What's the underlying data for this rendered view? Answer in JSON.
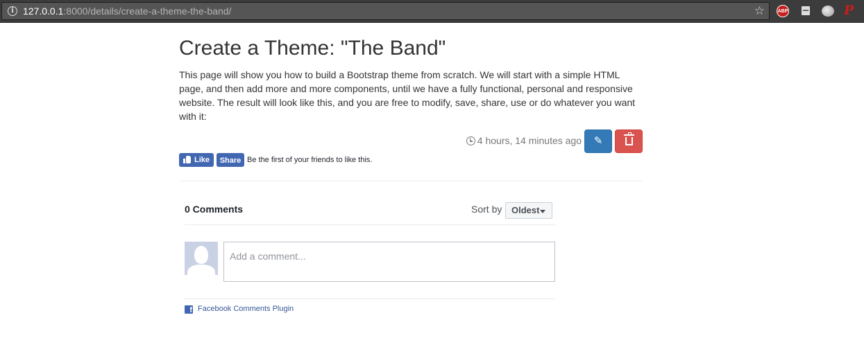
{
  "browser": {
    "url_host": "127.0.0.1",
    "url_path": ":8000/details/create-a-theme-the-band/",
    "info_icon": "info-icon",
    "star_icon": "star-icon",
    "extensions": [
      {
        "name": "adblock-plus-icon",
        "label": "ABP"
      },
      {
        "name": "document-icon"
      },
      {
        "name": "cloud-icon"
      },
      {
        "name": "pinterest-icon",
        "label": "P"
      }
    ]
  },
  "page": {
    "title": "Create a Theme: \"The Band\"",
    "description": "This page will show you how to build a Bootstrap theme from scratch. We will start with a simple HTML page, and then add more and more components, until we have a fully functional, personal and responsive website. The result will look like this, and you are free to modify, save, share, use or do whatever you want with it:",
    "timestamp": "4 hours, 14 minutes ago",
    "edit_icon": "pencil-icon",
    "delete_icon": "trash-icon",
    "colors": {
      "primary": "#337ab7",
      "danger": "#d9534f",
      "facebook": "#4267b2"
    }
  },
  "facebook": {
    "like_label": "Like",
    "share_label": "Share",
    "like_text": "Be the first of your friends to like this."
  },
  "comments": {
    "count_label": "0 Comments",
    "sort_label": "Sort by",
    "sort_value": "Oldest",
    "placeholder": "Add a comment...",
    "plugin_label": "Facebook Comments Plugin",
    "plugin_icon_glyph": "f"
  }
}
